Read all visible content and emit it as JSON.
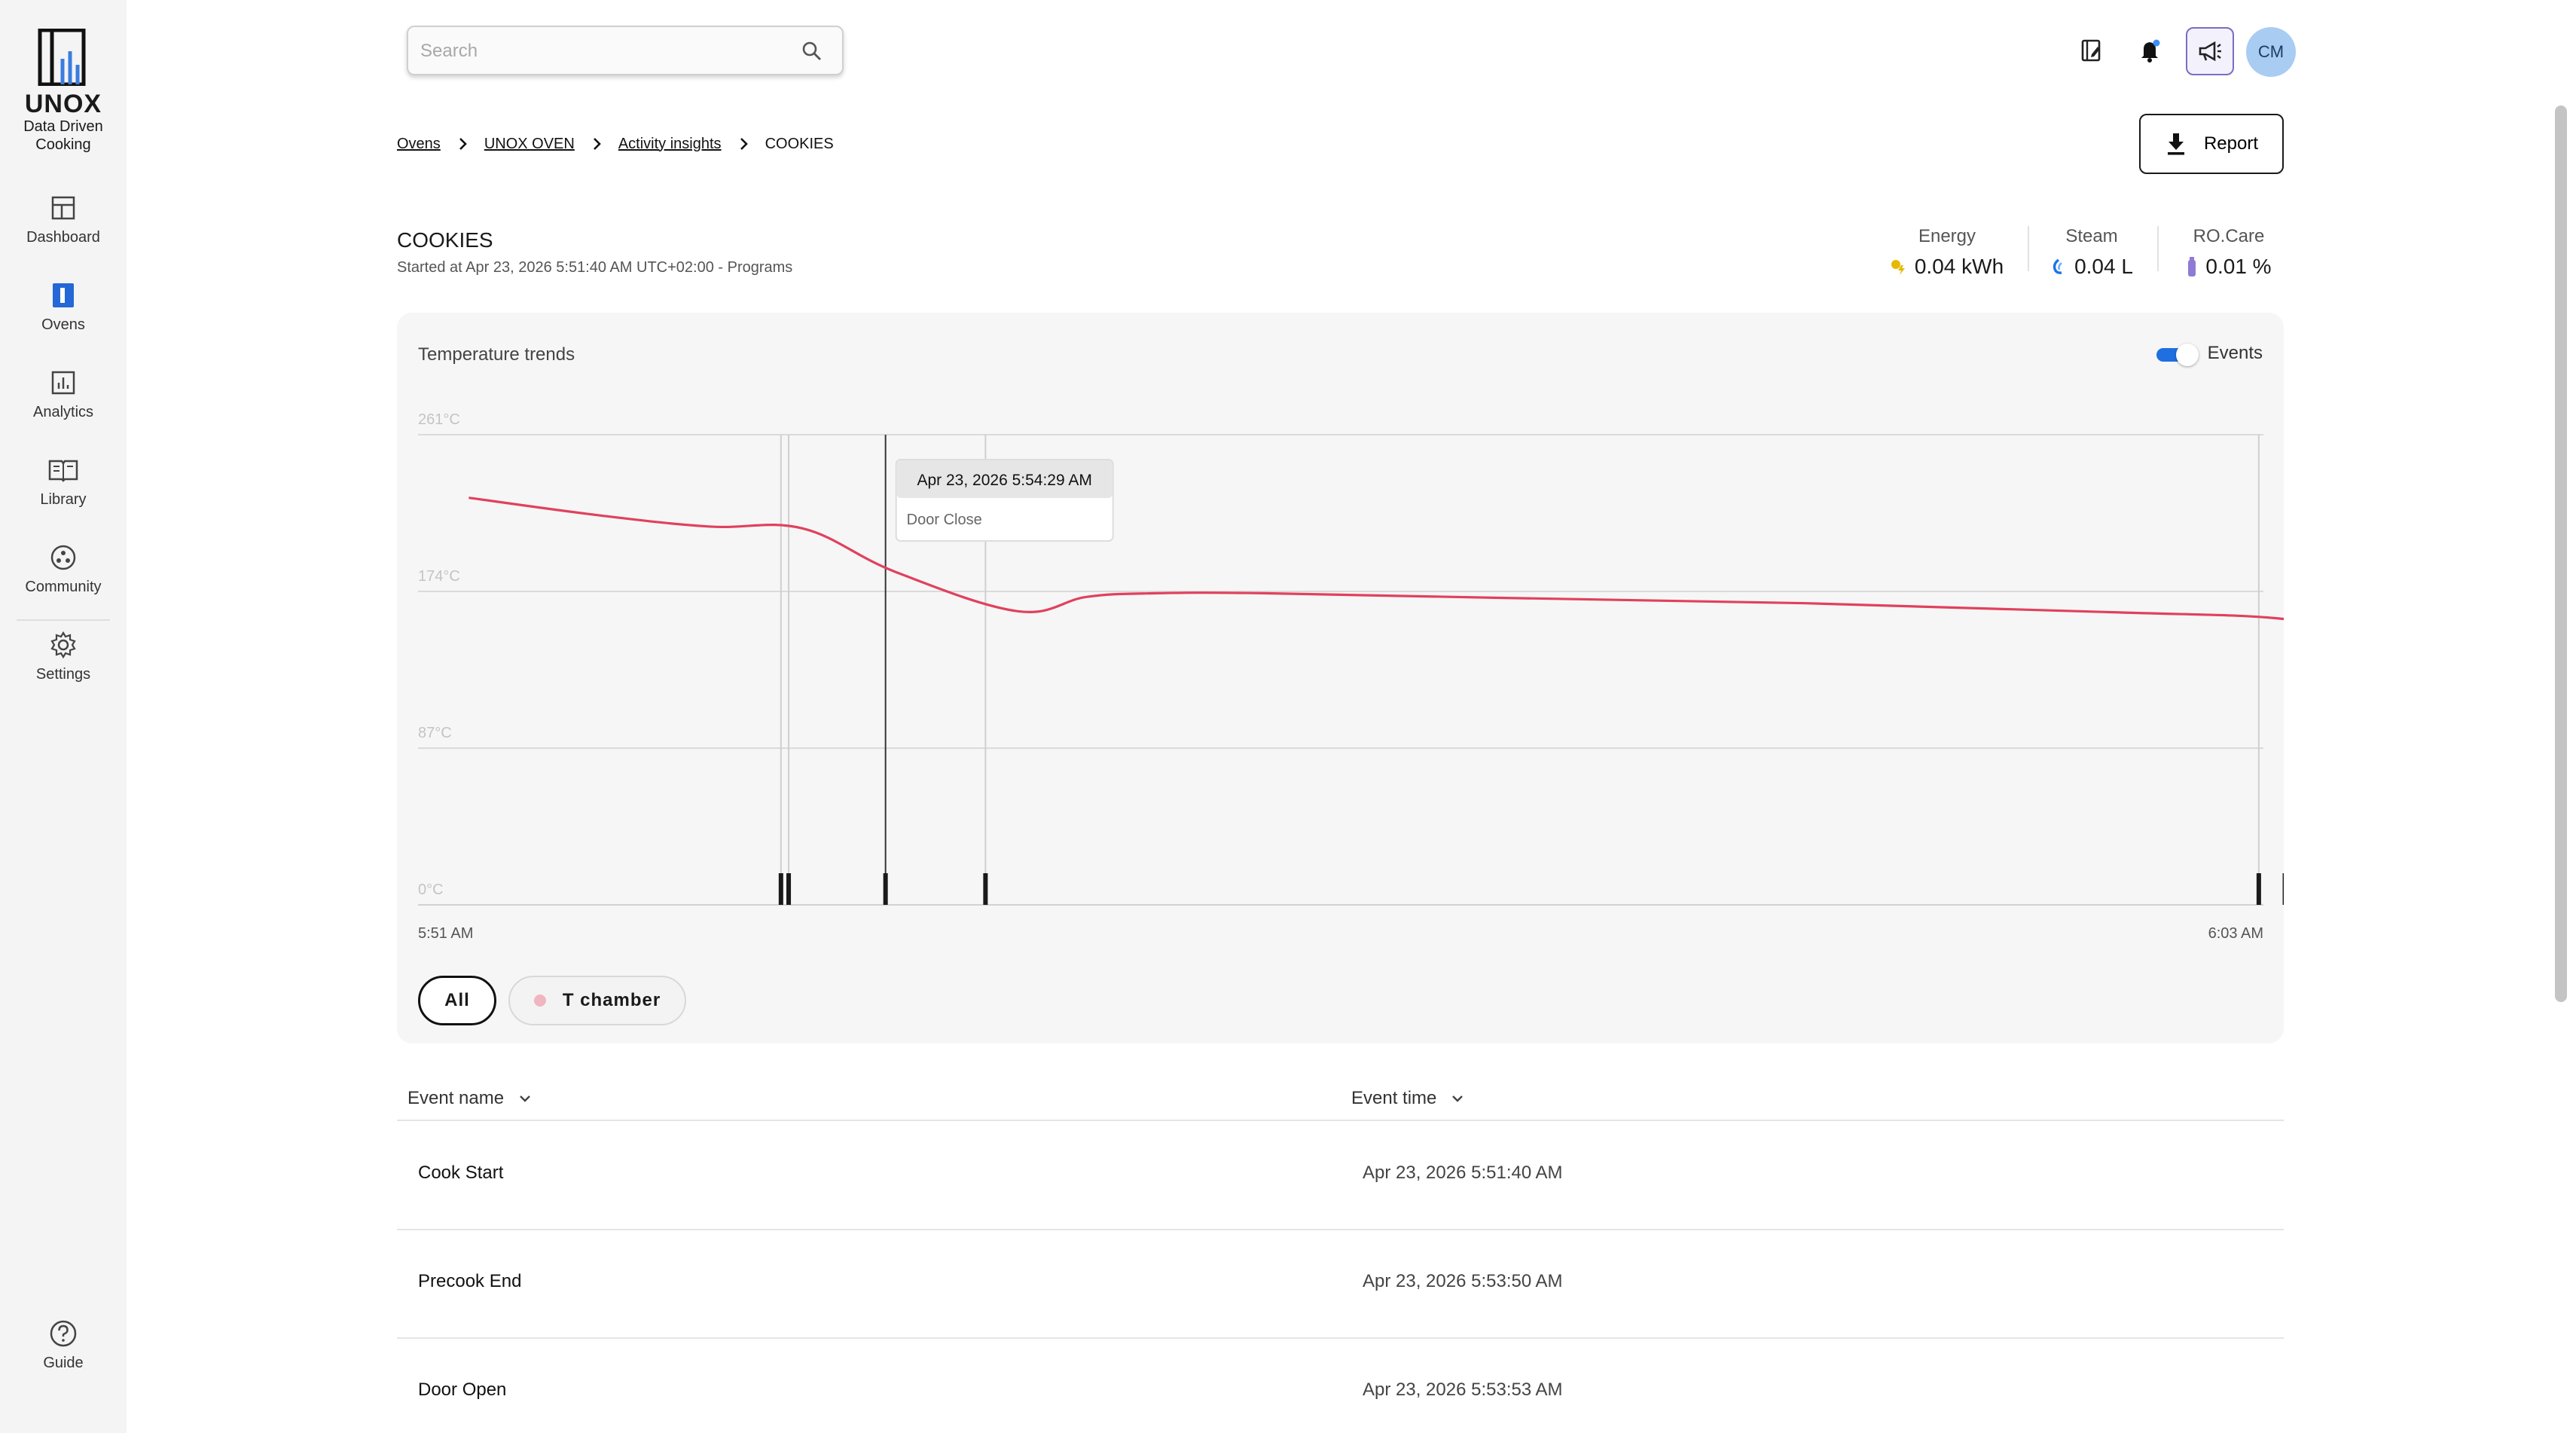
{
  "brand": {
    "name": "UNOX",
    "tagline_1": "Data Driven",
    "tagline_2": "Cooking"
  },
  "sidebar": {
    "items": [
      {
        "label": "Dashboard",
        "icon": "dashboard-icon"
      },
      {
        "label": "Ovens",
        "icon": "oven-icon",
        "active": true
      },
      {
        "label": "Analytics",
        "icon": "analytics-icon"
      },
      {
        "label": "Library",
        "icon": "book-icon"
      },
      {
        "label": "Community",
        "icon": "community-icon"
      },
      {
        "label": "Settings",
        "icon": "gear-icon"
      }
    ],
    "guide": {
      "label": "Guide",
      "icon": "help-icon"
    }
  },
  "search": {
    "placeholder": "Search"
  },
  "header": {
    "avatar_initials": "CM"
  },
  "breadcrumb": {
    "items": [
      "Ovens",
      "UNOX OVEN",
      "Activity insights"
    ],
    "current": "COOKIES"
  },
  "report_button": {
    "label": "Report"
  },
  "program": {
    "title": "COOKIES",
    "subtitle": "Started at Apr 23, 2026 5:51:40 AM UTC+02:00 - Programs"
  },
  "stats": [
    {
      "label": "Energy",
      "value": "0.04 kWh",
      "icon": "energy-icon",
      "color": "#e6b800"
    },
    {
      "label": "Steam",
      "value": "0.04 L",
      "icon": "steam-icon",
      "color": "#1e73e8"
    },
    {
      "label": "RO.Care",
      "value": "0.01 %",
      "icon": "rocare-icon",
      "color": "#8f7ad6"
    }
  ],
  "chart_card": {
    "title": "Temperature trends",
    "events_toggle_label": "Events",
    "events_enabled": true
  },
  "chart_data": {
    "type": "line",
    "ylim": [
      0,
      261
    ],
    "y_ticks": [
      {
        "value": 0,
        "label": "0°C"
      },
      {
        "value": 87,
        "label": "87°C"
      },
      {
        "value": 174,
        "label": "174°C"
      },
      {
        "value": 261,
        "label": "261°C"
      }
    ],
    "x_range_minutes": [
      0,
      12
    ],
    "x_tick_labels": [
      "5:51 AM",
      "6:03 AM"
    ],
    "series": [
      {
        "name": "T chamber",
        "color": "#e0415d",
        "points": [
          [
            0.33,
            226
          ],
          [
            1.2,
            216
          ],
          [
            1.9,
            210
          ],
          [
            2.5,
            209
          ],
          [
            3.1,
            185
          ],
          [
            3.9,
            163
          ],
          [
            4.35,
            171
          ],
          [
            4.8,
            173
          ],
          [
            5.5,
            173
          ],
          [
            7.0,
            170.5
          ],
          [
            9.0,
            167.5
          ],
          [
            11.0,
            162.5
          ],
          [
            12.1,
            159
          ],
          [
            12.55,
            150
          ]
        ]
      }
    ],
    "event_markers_minutes": [
      2.36,
      2.41,
      3.04,
      3.69,
      11.97,
      12.14
    ],
    "tooltip": {
      "event_minute": 3.04,
      "time_label": "Apr 23, 2026 5:54:29 AM",
      "event_label": "Door Close"
    }
  },
  "filters": {
    "all_label": "All",
    "series_label": "T chamber"
  },
  "events_table": {
    "columns": [
      "Event name",
      "Event time"
    ],
    "rows": [
      {
        "name": "Cook Start",
        "time": "Apr 23, 2026 5:51:40 AM"
      },
      {
        "name": "Precook End",
        "time": "Apr 23, 2026 5:53:50 AM"
      },
      {
        "name": "Door Open",
        "time": "Apr 23, 2026 5:53:53 AM"
      }
    ]
  }
}
